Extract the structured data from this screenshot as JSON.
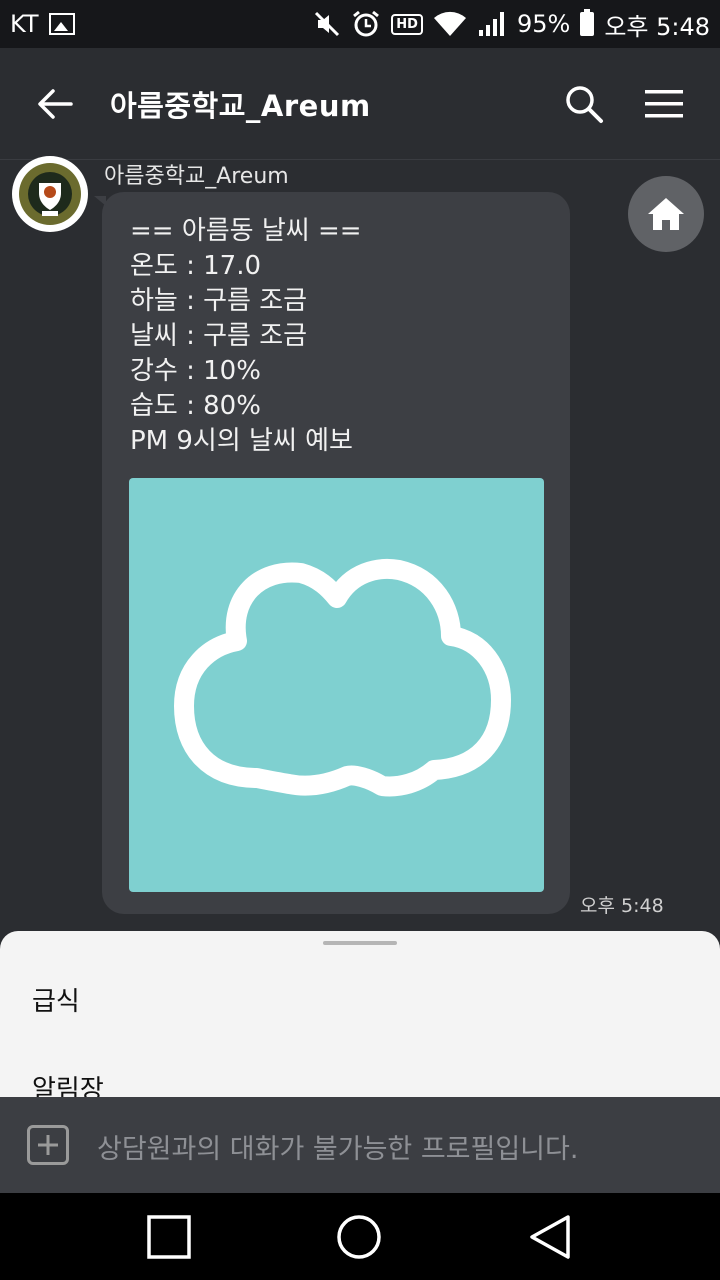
{
  "status_bar": {
    "carrier": "KT",
    "battery": "95%",
    "time": "오후 5:48",
    "hd_label": "HD",
    "icons": [
      "gallery-icon",
      "mute-icon",
      "alarm-icon",
      "hd-icon",
      "wifi-icon",
      "signal-icon",
      "battery-icon"
    ]
  },
  "header": {
    "title": "아름중학교_Areum",
    "icons": [
      "back-arrow-icon",
      "search-icon",
      "menu-icon"
    ]
  },
  "message": {
    "sender": "아름중학교_Areum",
    "lines": [
      "== 아름동 날씨 ==",
      "온도 : 17.0",
      "하늘 : 구름 조금",
      "날씨 : 구름 조금",
      "강수 : 10%",
      "습도 : 80%",
      "PM 9시의 날씨 예보"
    ],
    "image_icon": "cloud-icon",
    "timestamp": "오후 5:48"
  },
  "quick_replies": {
    "items": [
      "급식",
      "알림장"
    ]
  },
  "input": {
    "placeholder": "상담원과의 대화가 불가능한 프로필입니다."
  },
  "nav_bar": {
    "icons": [
      "recents-square-icon",
      "home-circle-icon",
      "back-triangle-icon"
    ]
  },
  "colors": {
    "background": "#2b2d31",
    "bubble": "#3d3f44",
    "weather_image_bg": "#7fd0d0",
    "sheet": "#f4f4f4"
  }
}
